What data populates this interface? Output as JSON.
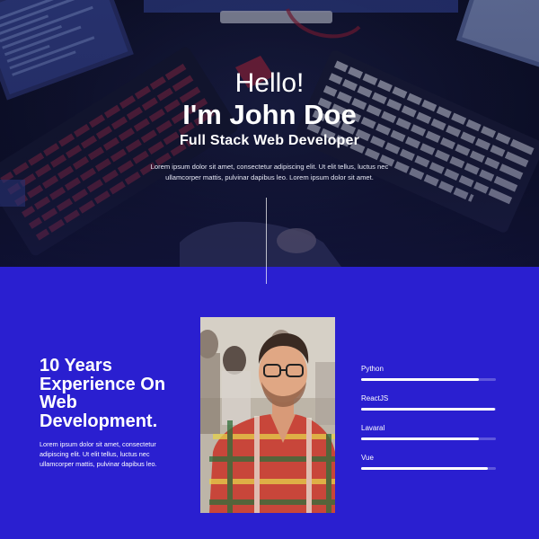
{
  "hero": {
    "greeting": "Hello!",
    "name": "I'm John Doe",
    "role": "Full Stack Web Developer",
    "description": "Lorem ipsum dolor sit amet, consectetur adipiscing elit. Ut elit tellus, luctus nec ullamcorper mattis, pulvinar dapibus leo. Lorem ipsum dolor sit amet."
  },
  "about": {
    "experience_title": "10 Years Experience On Web Development.",
    "experience_desc": "Lorem ipsum dolor sit amet, consectetur adipiscing elit. Ut elit tellus, luctus nec ullamcorper mattis, pulvinar dapibus leo.",
    "photo_icon": "portrait-photo"
  },
  "skills": [
    {
      "label": "Python",
      "level": 0.87
    },
    {
      "label": "ReactJS",
      "level": 0.99
    },
    {
      "label": "Lavaral",
      "level": 0.87
    },
    {
      "label": "Vue",
      "level": 0.94
    }
  ],
  "colors": {
    "accent": "#2a1fd0",
    "text": "#ffffff"
  }
}
